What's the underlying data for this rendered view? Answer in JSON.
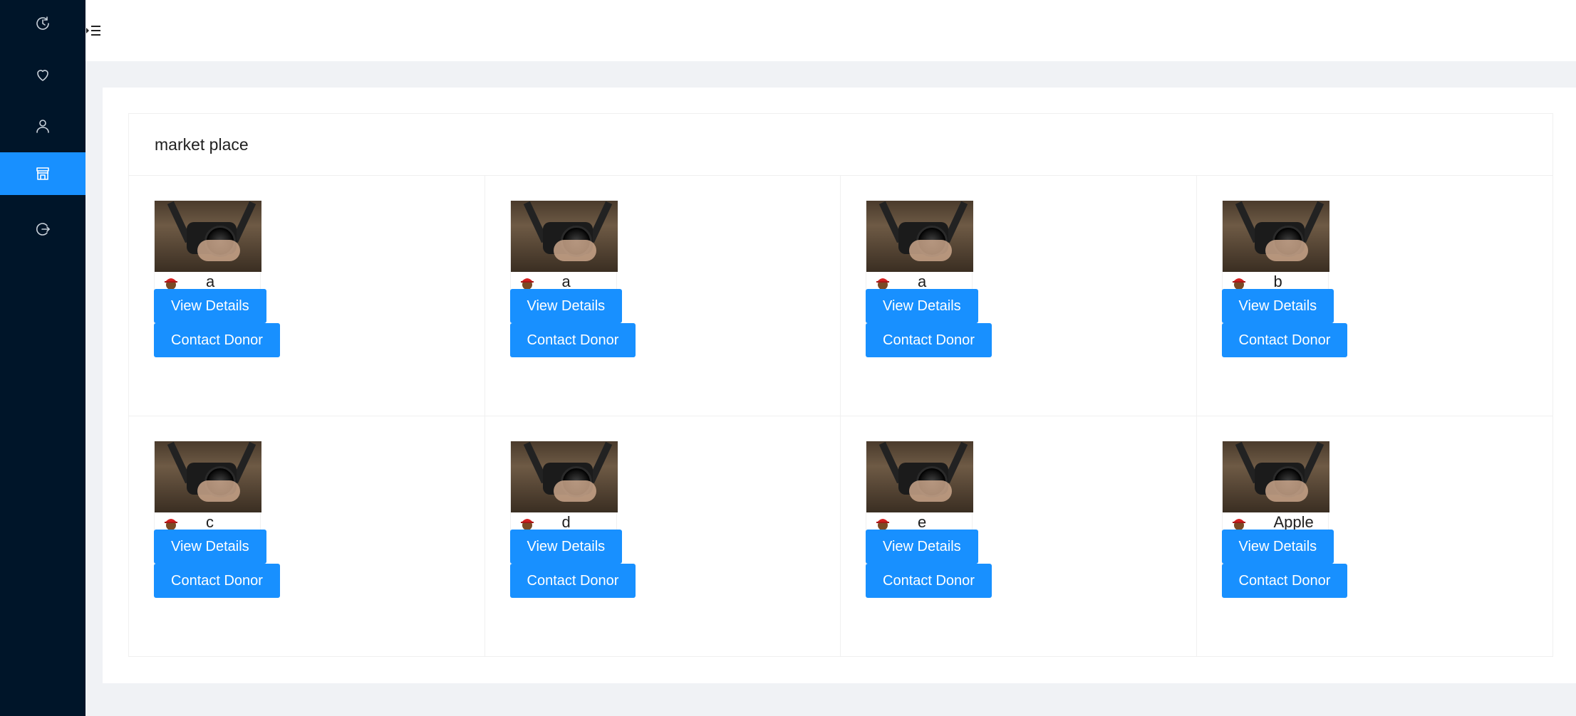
{
  "sidebar": {
    "items": [
      {
        "icon": "history-icon"
      },
      {
        "icon": "heart-icon"
      },
      {
        "icon": "user-icon"
      },
      {
        "icon": "shop-icon",
        "active": true
      },
      {
        "icon": "logout-icon"
      }
    ]
  },
  "header": {
    "menu_icon": "menu-unfold-icon"
  },
  "main": {
    "title": "market place",
    "items": [
      {
        "title": "a",
        "description": "a",
        "view_label": "View Details",
        "contact_label": "Contact Donor"
      },
      {
        "title": "a",
        "description": "a",
        "view_label": "View Details",
        "contact_label": "Contact Donor"
      },
      {
        "title": "a",
        "description": "a",
        "view_label": "View Details",
        "contact_label": "Contact Donor"
      },
      {
        "title": "b",
        "description": "b",
        "view_label": "View Details",
        "contact_label": "Contact Donor"
      },
      {
        "title": "c",
        "description": "c",
        "view_label": "View Details",
        "contact_label": "Contact Donor"
      },
      {
        "title": "d",
        "description": "d",
        "view_label": "View Details",
        "contact_label": "Contact Donor"
      },
      {
        "title": "e",
        "description": "e",
        "view_label": "View Details",
        "contact_label": "Contact Donor"
      },
      {
        "title": "Apple",
        "description": "Apple",
        "view_label": "View Details",
        "contact_label": "Contact Donor"
      }
    ]
  },
  "colors": {
    "sidebar_bg": "#001529",
    "accent": "#1890ff",
    "page_bg": "#f0f2f5"
  }
}
